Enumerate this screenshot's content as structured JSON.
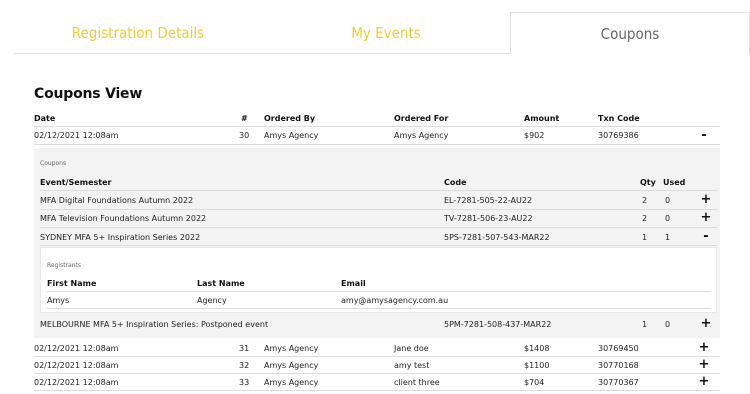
{
  "tabs": [
    {
      "label": "Registration Details"
    },
    {
      "label": "My Events"
    },
    {
      "label": "Coupons"
    }
  ],
  "page_title": "Coupons View",
  "columns": {
    "date": "Date",
    "num": "#",
    "ordered_by": "Ordered By",
    "ordered_for": "Ordered For",
    "amount": "Amount",
    "txn_code": "Txn Code"
  },
  "orders": [
    {
      "date": "02/12/2021 12:08am",
      "num": "30",
      "ordered_by": "Amys Agency",
      "ordered_for": "Amys Agency",
      "amount": "$902",
      "txn_code": "30769386",
      "toggle": "-"
    },
    {
      "date": "02/12/2021 12:08am",
      "num": "31",
      "ordered_by": "Amys Agency",
      "ordered_for": "Jane doe",
      "amount": "$1408",
      "txn_code": "30769450",
      "toggle": "+"
    },
    {
      "date": "02/12/2021 12:08am",
      "num": "32",
      "ordered_by": "Amys Agency",
      "ordered_for": "amy test",
      "amount": "$1100",
      "txn_code": "30770168",
      "toggle": "+"
    },
    {
      "date": "02/12/2021 12:08am",
      "num": "33",
      "ordered_by": "Amys Agency",
      "ordered_for": "client three",
      "amount": "$704",
      "txn_code": "30770367",
      "toggle": "+"
    }
  ],
  "coupons": {
    "caption": "Coupons",
    "columns": {
      "event": "Event/Semester",
      "code": "Code",
      "qty": "Qty",
      "used": "Used"
    },
    "rows": [
      {
        "event": "MFA Digital Foundations Autumn 2022",
        "code": "EL-7281-505-22-AU22",
        "qty": "2",
        "used": "0",
        "toggle": "+"
      },
      {
        "event": "MFA Television Foundations Autumn 2022",
        "code": "TV-7281-506-23-AU22",
        "qty": "2",
        "used": "0",
        "toggle": "+"
      },
      {
        "event": "SYDNEY MFA 5+ Inspiration Series 2022",
        "code": "5PS-7281-507-543-MAR22",
        "qty": "1",
        "used": "1",
        "toggle": "-"
      },
      {
        "event": "MELBOURNE MFA 5+ Inspiration Series: Postponed event",
        "code": "5PM-7281-508-437-MAR22",
        "qty": "1",
        "used": "0",
        "toggle": "+"
      }
    ]
  },
  "registrants": {
    "caption": "Registrants",
    "columns": {
      "first": "First Name",
      "last": "Last Name",
      "email": "Email"
    },
    "rows": [
      {
        "first": "Amys",
        "last": "Agency",
        "email": "amy@amysagency.com.au"
      }
    ]
  },
  "colors": {
    "tab_inactive": "#f2cc3a",
    "tab_active": "#666666",
    "panel_bg": "#f3f3f3"
  },
  "icons": {
    "expand": "plus-icon",
    "collapse": "minus-icon"
  }
}
